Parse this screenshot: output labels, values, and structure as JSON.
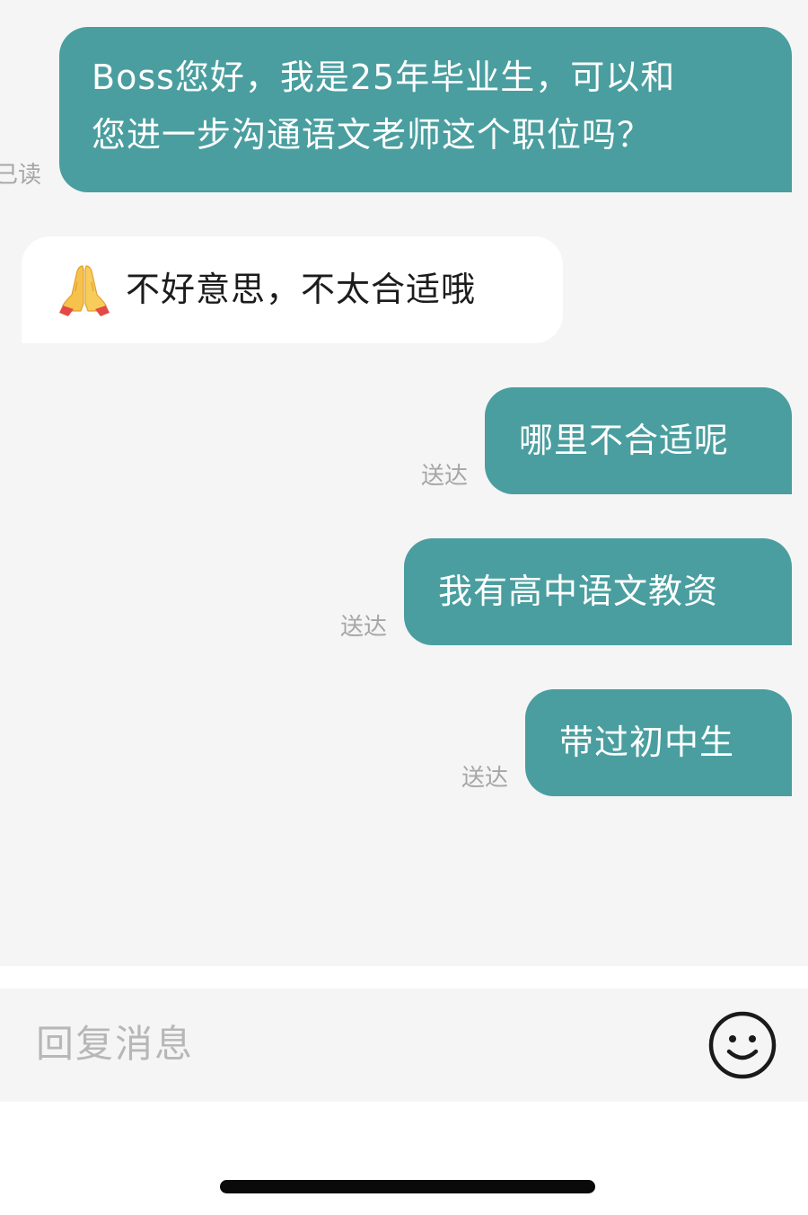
{
  "messages": [
    {
      "direction": "outgoing",
      "lines": [
        "Boss您好，我是25年毕业生，可以和",
        "您进一步沟通语文老师这个职位吗？"
      ],
      "status": "已读"
    },
    {
      "direction": "incoming",
      "emoji": "folded-hands",
      "text": "不好意思，不太合适哦"
    },
    {
      "direction": "outgoing",
      "text": "哪里不合适呢",
      "status": "送达"
    },
    {
      "direction": "outgoing",
      "text": "我有高中语文教资",
      "status": "送达"
    },
    {
      "direction": "outgoing",
      "text": "带过初中生",
      "status": "送达"
    }
  ],
  "input": {
    "placeholder": "回复消息",
    "value": ""
  },
  "icons": {
    "emoji_button": "smiley-face-icon"
  },
  "colors": {
    "outgoing_bubble": "#4a9e9f",
    "incoming_bubble": "#ffffff",
    "background": "#f5f5f5",
    "status_text": "#a6a6a6"
  }
}
